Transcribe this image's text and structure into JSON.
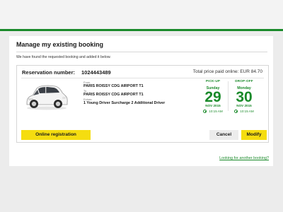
{
  "page": {
    "title": "Manage my existing booking",
    "subtitle": "We have found the requested booking and added it below."
  },
  "booking": {
    "reservation_label": "Reservation number:",
    "reservation_number": "1024443489",
    "price_text": "Total price paid online:  EUR 84.70",
    "from_label": "From",
    "from_location": "PARIS ROISSY CDG AIRPORT T1",
    "to_label": "To",
    "to_location": "PARIS ROISSY CDG AIRPORT T1",
    "extras_label": "Extras:",
    "extras": "1  Young Driver Surcharge  2  Additional Driver"
  },
  "pickup": {
    "heading": "PICK-UP",
    "weekday": "Sunday",
    "day": "29",
    "month_year": "NOV 2015",
    "time": "10:15 AM"
  },
  "dropoff": {
    "heading": "DROP-OFF",
    "weekday": "Monday",
    "day": "30",
    "month_year": "NOV 2015",
    "time": "10:15 AM"
  },
  "actions": {
    "online_registration": "Online registration",
    "cancel": "Cancel",
    "modify": "Modify"
  },
  "links": {
    "another_booking": "Looking for another booking?"
  },
  "colors": {
    "accent_green": "#1a8a2a",
    "button_yellow": "#f5dd10"
  }
}
